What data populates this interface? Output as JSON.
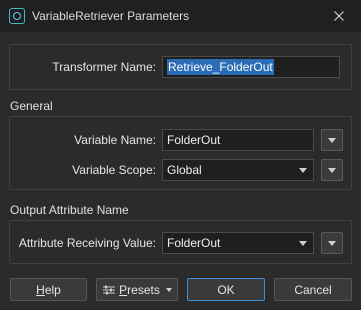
{
  "window": {
    "title": "VariableRetriever Parameters"
  },
  "transformer": {
    "label": "Transformer Name:",
    "value": "Retrieve_FolderOut"
  },
  "general": {
    "section_title": "General",
    "variable_name_label": "Variable Name:",
    "variable_name_value": "FolderOut",
    "variable_scope_label": "Variable Scope:",
    "variable_scope_value": "Global"
  },
  "output": {
    "section_title": "Output Attribute Name",
    "attribute_label": "Attribute Receiving Value:",
    "attribute_value": "FolderOut"
  },
  "buttons": {
    "help": "Help",
    "presets": "Presets",
    "ok": "OK",
    "cancel": "Cancel"
  },
  "colors": {
    "background": "#2b2b2b",
    "titlebar": "#202020",
    "selection": "#2a6cb6",
    "primary_border": "#3d8fd6"
  }
}
